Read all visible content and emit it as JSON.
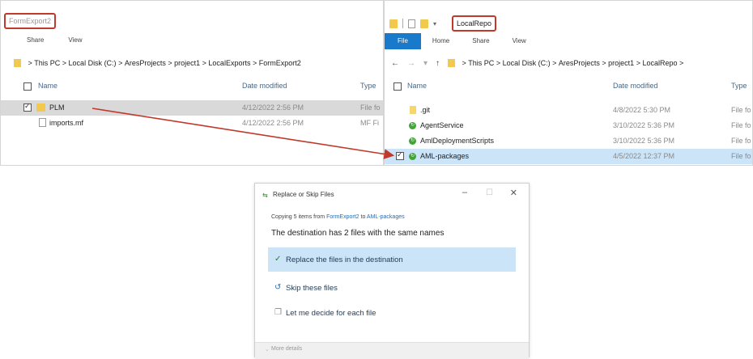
{
  "left_window": {
    "title": "FormExport2",
    "ribbon": [
      "Share",
      "View"
    ],
    "address": [
      "This PC",
      "Local Disk (C:)",
      "AresProjects",
      "project1",
      "LocalExports",
      "FormExport2"
    ],
    "columns": {
      "name": "Name",
      "date": "Date modified",
      "type": "Type"
    },
    "rows": [
      {
        "name": "PLM",
        "date": "4/12/2022 2:56 PM",
        "type": "File fo",
        "icon": "folder-icon",
        "checked": true
      },
      {
        "name": "imports.mf",
        "date": "4/12/2022 2:56 PM",
        "type": "MF Fi",
        "icon": "file-icon",
        "checked": false
      }
    ]
  },
  "right_window": {
    "title": "LocalRepo",
    "ribbon": [
      "File",
      "Home",
      "Share",
      "View"
    ],
    "address": [
      "This PC",
      "Local Disk (C:)",
      "AresProjects",
      "project1",
      "LocalRepo"
    ],
    "columns": {
      "name": "Name",
      "date": "Date modified",
      "type": "Type"
    },
    "rows": [
      {
        "name": ".git",
        "date": "4/8/2022 5:30 PM",
        "type": "File fo",
        "icon": "git-icon"
      },
      {
        "name": "AgentService",
        "date": "3/10/2022 5:36 PM",
        "type": "File fo",
        "icon": "sync-icon"
      },
      {
        "name": "AmlDeploymentScripts",
        "date": "3/10/2022 5:36 PM",
        "type": "File fo",
        "icon": "sync-icon"
      },
      {
        "name": "AML-packages",
        "date": "4/5/2022 12:37 PM",
        "type": "File fo",
        "icon": "sync-icon",
        "checked": true
      }
    ]
  },
  "dialog": {
    "title": "Replace or Skip Files",
    "copying_prefix": "Copying 5 items from",
    "copying_source": "FormExport2",
    "copying_to": "to",
    "copying_dest": "AML-packages",
    "heading": "The destination has 2 files with the same names",
    "options": {
      "replace": "Replace the files in the destination",
      "skip": "Skip these files",
      "decide": "Let me decide for each file"
    },
    "more_details": "More details",
    "controls": {
      "minimize": "–",
      "maximize": "☐",
      "close": "✕"
    }
  },
  "colors": {
    "highlight_box": "#c0392b",
    "selection_blue": "#cce4f7",
    "file_tab": "#1979ca",
    "arrow": "#c0392b"
  }
}
